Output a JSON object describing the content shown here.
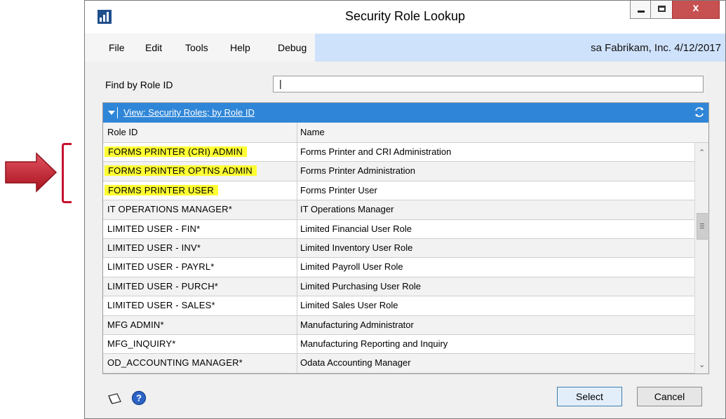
{
  "window": {
    "title": "Security Role Lookup",
    "close_glyph": "x"
  },
  "menu": {
    "items": [
      "File",
      "Edit",
      "Tools",
      "Help",
      "Debug"
    ],
    "company_info": "sa  Fabrikam, Inc. 4/12/2017"
  },
  "find": {
    "label": "Find by Role ID",
    "value": "|"
  },
  "view": {
    "label": "View: Security Roles; by Role ID"
  },
  "table": {
    "columns": [
      "Role ID",
      "Name"
    ],
    "rows": [
      {
        "id": "FORMS PRINTER (CRI) ADMIN",
        "name": "Forms Printer and CRI Administration",
        "highlight": true
      },
      {
        "id": "FORMS PRINTER OPTNS ADMIN",
        "name": "Forms Printer Administration",
        "highlight": true
      },
      {
        "id": "FORMS PRINTER USER",
        "name": "Forms Printer User",
        "highlight": true
      },
      {
        "id": "IT OPERATIONS MANAGER*",
        "name": "IT Operations Manager",
        "highlight": false
      },
      {
        "id": "LIMITED USER - FIN*",
        "name": "Limited Financial User Role",
        "highlight": false
      },
      {
        "id": "LIMITED USER - INV*",
        "name": "Limited Inventory User Role",
        "highlight": false
      },
      {
        "id": "LIMITED USER - PAYRL*",
        "name": "Limited Payroll User Role",
        "highlight": false
      },
      {
        "id": "LIMITED USER - PURCH*",
        "name": "Limited Purchasing User Role",
        "highlight": false
      },
      {
        "id": "LIMITED USER - SALES*",
        "name": "Limited Sales User Role",
        "highlight": false
      },
      {
        "id": "MFG ADMIN*",
        "name": "Manufacturing Administrator",
        "highlight": false
      },
      {
        "id": "MFG_INQUIRY*",
        "name": "Manufacturing Reporting and Inquiry",
        "highlight": false
      },
      {
        "id": "OD_ACCOUNTING MANAGER*",
        "name": "Odata Accounting Manager",
        "highlight": false
      }
    ]
  },
  "buttons": {
    "select": "Select",
    "cancel": "Cancel"
  },
  "colors": {
    "highlight": "#ffff33",
    "view_bar": "#2f86d8",
    "annotation": "#c8102e"
  }
}
